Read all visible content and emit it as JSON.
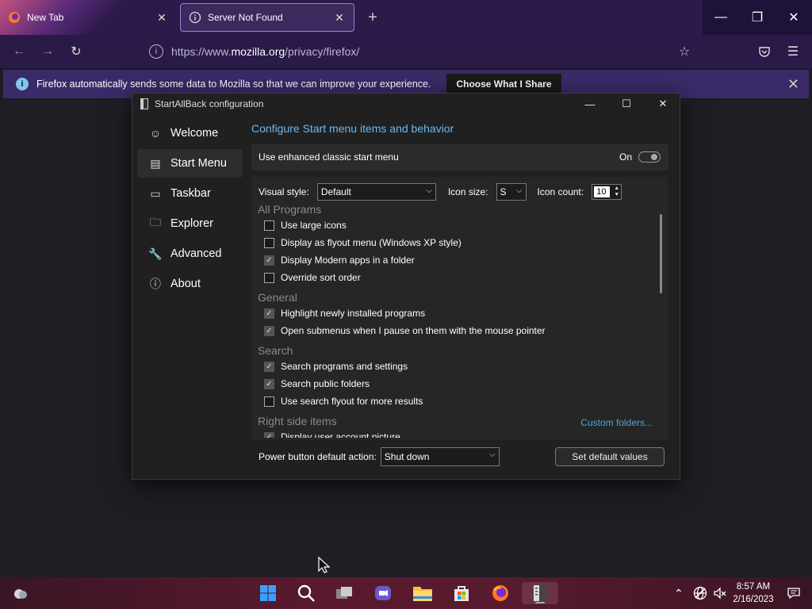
{
  "browser": {
    "tabs": [
      {
        "title": "New Tab",
        "icon": "firefox-icon"
      },
      {
        "title": "Server Not Found",
        "icon": "info-icon"
      }
    ],
    "new_tab": "+",
    "url": {
      "prefix": "https://www.",
      "host": "mozilla.org",
      "path": "/privacy/firefox/"
    },
    "notification": {
      "message": "Firefox automatically sends some data to Mozilla so that we can improve your experience.",
      "button": "Choose What I Share"
    }
  },
  "dialog": {
    "title": "StartAllBack configuration",
    "sidebar": [
      {
        "label": "Welcome",
        "icon": "smiley-icon",
        "glyph": "☺"
      },
      {
        "label": "Start Menu",
        "icon": "start-menu-icon",
        "glyph": "▤"
      },
      {
        "label": "Taskbar",
        "icon": "taskbar-icon",
        "glyph": "▭"
      },
      {
        "label": "Explorer",
        "icon": "folder-icon",
        "glyph": "🗀"
      },
      {
        "label": "Advanced",
        "icon": "wrench-icon",
        "glyph": "🔧"
      },
      {
        "label": "About",
        "icon": "info-icon",
        "glyph": "ⓘ"
      }
    ],
    "selected": "Start Menu",
    "heading": "Configure Start menu items and behavior",
    "enhanced": {
      "label": "Use enhanced classic start menu",
      "state": "On"
    },
    "visual_style": {
      "label": "Visual style:",
      "value": "Default"
    },
    "icon_size": {
      "label": "Icon size:",
      "value": "S"
    },
    "icon_count": {
      "label": "Icon count:",
      "value": "10"
    },
    "groups": [
      {
        "title": "All Programs",
        "items": [
          {
            "label": "Use large icons",
            "checked": false
          },
          {
            "label": "Display as flyout menu (Windows XP style)",
            "checked": false
          },
          {
            "label": "Display Modern apps in a folder",
            "checked": true
          },
          {
            "label": "Override sort order",
            "checked": false
          }
        ]
      },
      {
        "title": "General",
        "items": [
          {
            "label": "Highlight newly installed programs",
            "checked": true
          },
          {
            "label": "Open submenus when I pause on them with the mouse pointer",
            "checked": true
          }
        ]
      },
      {
        "title": "Search",
        "items": [
          {
            "label": "Search programs and settings",
            "checked": true
          },
          {
            "label": "Search public folders",
            "checked": true
          },
          {
            "label": "Use search flyout for more results",
            "checked": false
          }
        ]
      },
      {
        "title": "Right side items",
        "items": [
          {
            "label": "Display user account picture",
            "checked": true
          }
        ]
      }
    ],
    "custom_folders": "Custom folders...",
    "power": {
      "label": "Power button default action:",
      "value": "Shut down"
    },
    "default_button": "Set default values"
  },
  "taskbar": {
    "clock_time": "8:57 AM",
    "clock_date": "2/16/2023"
  }
}
